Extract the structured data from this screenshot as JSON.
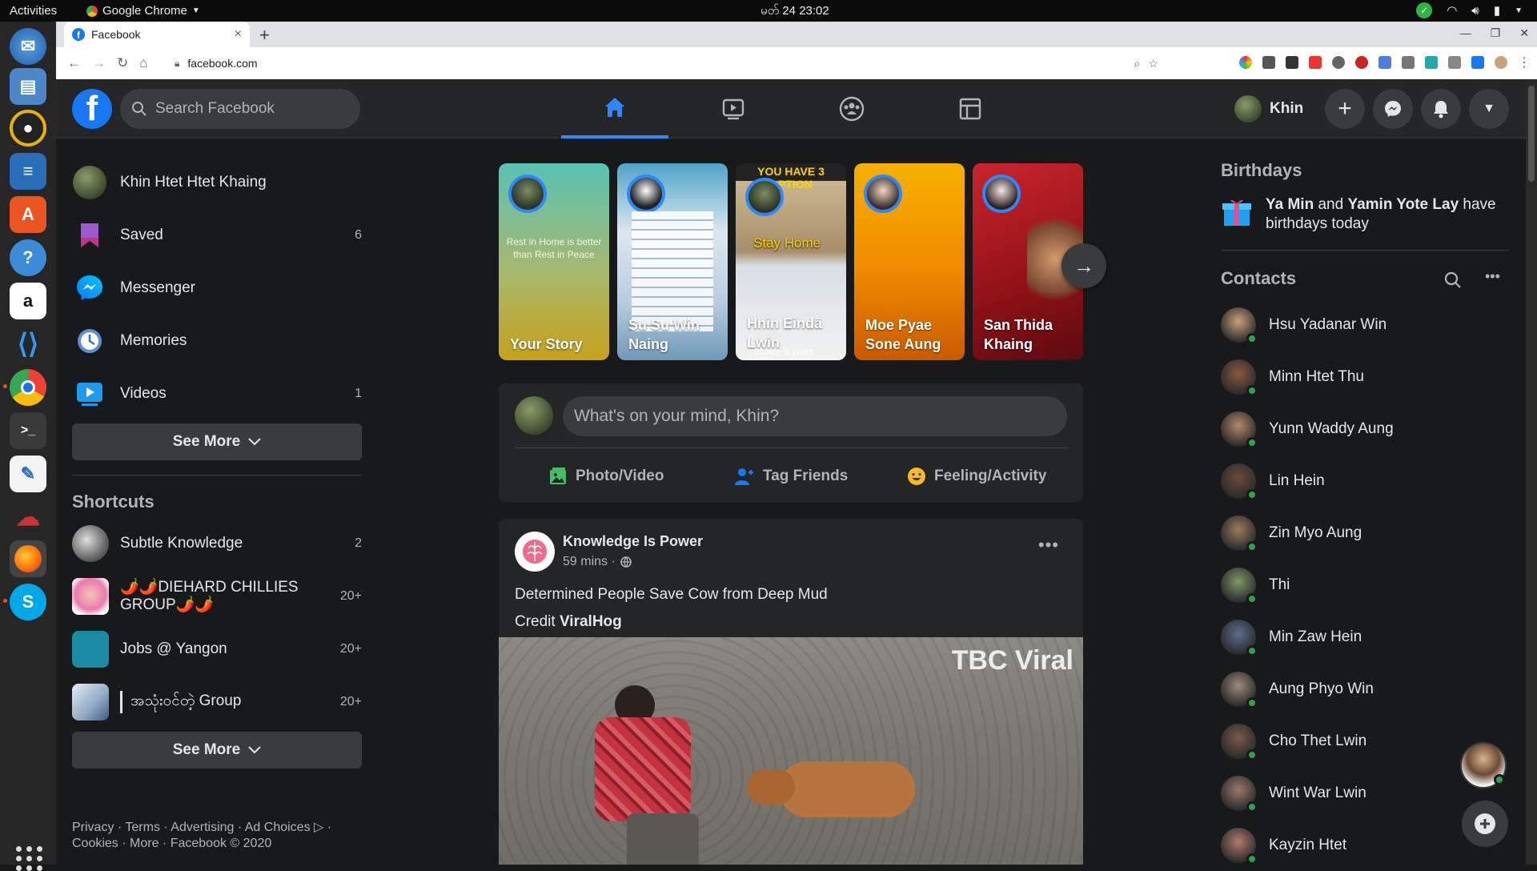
{
  "system": {
    "activities": "Activities",
    "app_name": "Google Chrome",
    "clock": "မတ် 24  23:02"
  },
  "browser": {
    "tab_title": "Facebook",
    "url": "facebook.com"
  },
  "header": {
    "search_placeholder": "Search Facebook",
    "profile_name": "Khin"
  },
  "left_nav": {
    "items": [
      {
        "label": "Khin Htet Htet Khaing",
        "count": ""
      },
      {
        "label": "Saved",
        "count": "6"
      },
      {
        "label": "Messenger",
        "count": ""
      },
      {
        "label": "Memories",
        "count": ""
      },
      {
        "label": "Videos",
        "count": "1"
      }
    ],
    "see_more": "See More",
    "shortcuts_title": "Shortcuts",
    "shortcuts": [
      {
        "label": "Subtle Knowledge",
        "count": "2"
      },
      {
        "label": "🌶️🌶️DIEHARD CHILLIES GROUP🌶️🌶️",
        "count": "20+"
      },
      {
        "label": "Jobs @ Yangon",
        "count": "20+"
      },
      {
        "label": "အသုံးဝင်တဲ့ Group",
        "count": "20+"
      }
    ],
    "shortcuts_see_more": "See More",
    "footer_line1": "Privacy · Terms · Advertising · Ad Choices ▷ ·",
    "footer_line2": "Cookies · More · Facebook © 2020"
  },
  "stories": [
    {
      "name": "Your Story",
      "caption": "Rest in Home is better than Rest in Peace"
    },
    {
      "name": "Su Su Win Naing"
    },
    {
      "name": "Hnin Eindā Lwin",
      "banner": "YOU HAVE 3 OPTION",
      "overlay": "Stay Home",
      "sub": "Choice is yours"
    },
    {
      "name": "Moe Pyae Sone Aung"
    },
    {
      "name": "San Thida Khaing"
    }
  ],
  "composer": {
    "placeholder": "What's on your mind, Khin?",
    "actions": [
      "Photo/Video",
      "Tag Friends",
      "Feeling/Activity"
    ]
  },
  "post": {
    "author": "Knowledge Is Power",
    "time": "59 mins ·",
    "text_line1": "Determined People Save Cow from Deep Mud",
    "credit_prefix": "Credit ",
    "credit_name": "ViralHog",
    "watermark": "TBC Viral"
  },
  "right_rail": {
    "birthdays_title": "Birthdays",
    "birthday_name1": "Ya Min",
    "birthday_and": " and ",
    "birthday_name2": "Yamin Yote Lay",
    "birthday_suffix": " have birthdays today",
    "contacts_title": "Contacts",
    "contacts": [
      "Hsu Yadanar Win",
      "Minn Htet Thu",
      "Yunn Waddy Aung",
      "Lin Hein",
      "Zin Myo Aung",
      "Thi",
      "Min Zaw Hein",
      "Aung Phyo Win",
      "Cho Thet Lwin",
      "Wint War Lwin",
      "Kayzin Htet"
    ]
  },
  "colors": {
    "fb_blue": "#1877f2",
    "active_tab": "#2d88ff",
    "online": "#31a24c"
  }
}
